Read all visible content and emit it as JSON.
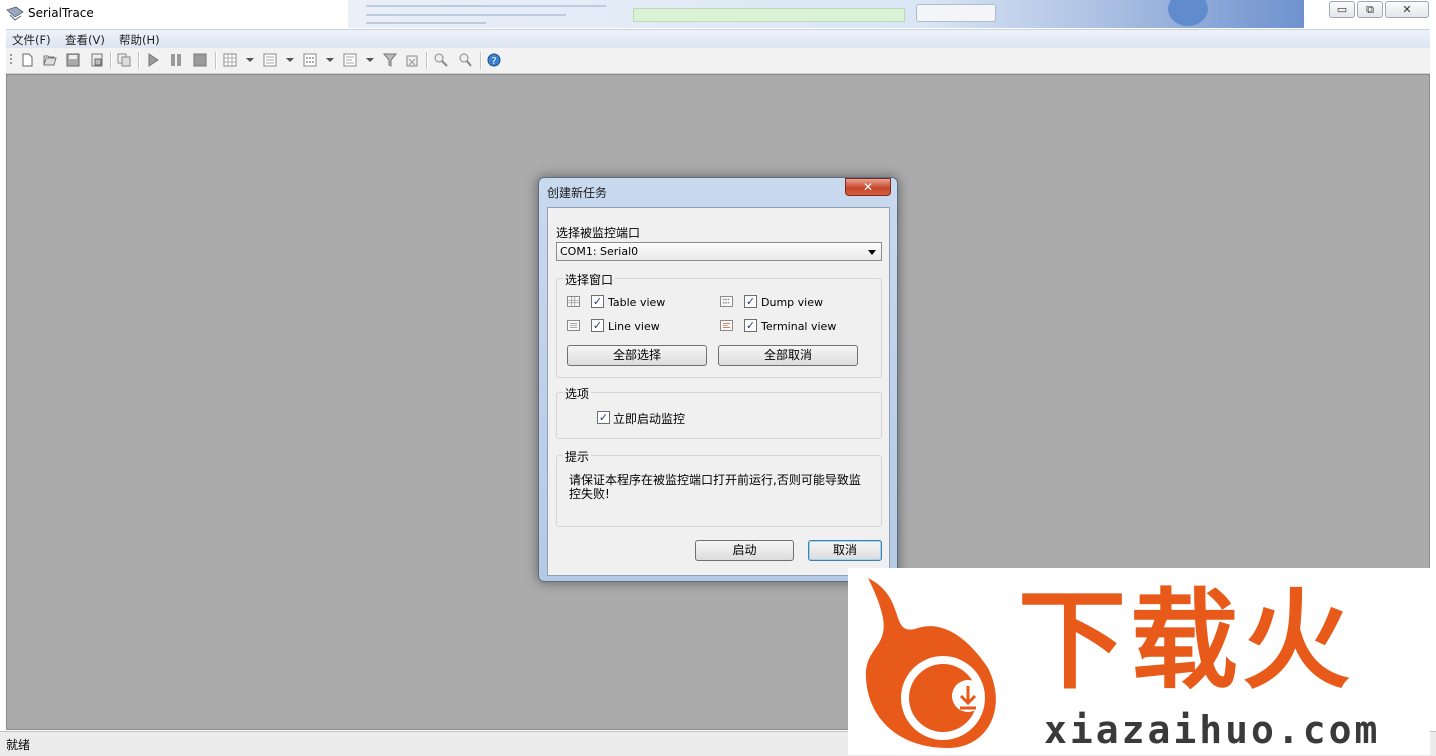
{
  "window": {
    "title": "SerialTrace",
    "buttons": {
      "minimize": "▭",
      "restore": "⧉",
      "close": "✕"
    }
  },
  "menu": [
    "文件(F)",
    "查看(V)",
    "帮助(H)"
  ],
  "toolbar": {
    "icons": [
      "new-file-icon",
      "open-icon",
      "save-icon",
      "save-as-icon",
      "copy-icon",
      "start-icon",
      "pause-icon",
      "stop-icon",
      "table-view-icon",
      "line-view-icon",
      "dump-view-icon",
      "terminal-view-icon",
      "filter-icon",
      "clear-icon",
      "find-icon",
      "find-next-icon",
      "help-icon"
    ]
  },
  "status": {
    "text": "就绪"
  },
  "dialog": {
    "title": "创建新任务",
    "close_label": "✕",
    "port_label": "选择被监控端口",
    "port_value": "COM1: Serial0",
    "windows_group": "选择窗口",
    "views": [
      {
        "label": "Table view",
        "checked": true
      },
      {
        "label": "Dump view",
        "checked": true
      },
      {
        "label": "Line view",
        "checked": true
      },
      {
        "label": "Terminal view",
        "checked": true
      }
    ],
    "select_all": "全部选择",
    "deselect_all": "全部取消",
    "options_group": "选项",
    "start_immediately": {
      "label": "立即启动监控",
      "checked": true
    },
    "hint_group": "提示",
    "hint_text": "请保证本程序在被监控端口打开前运行,否则可能导致监控失败!",
    "start_button": "启动",
    "cancel_button": "取消"
  },
  "watermark": {
    "brand": "下载火",
    "domain": "xiazaihuo.com"
  },
  "colors": {
    "workspace": "#ababab",
    "dialog_frame": "#c9d9ee",
    "close_red": "#c7472c",
    "watermark_orange": "#e85a1a"
  }
}
